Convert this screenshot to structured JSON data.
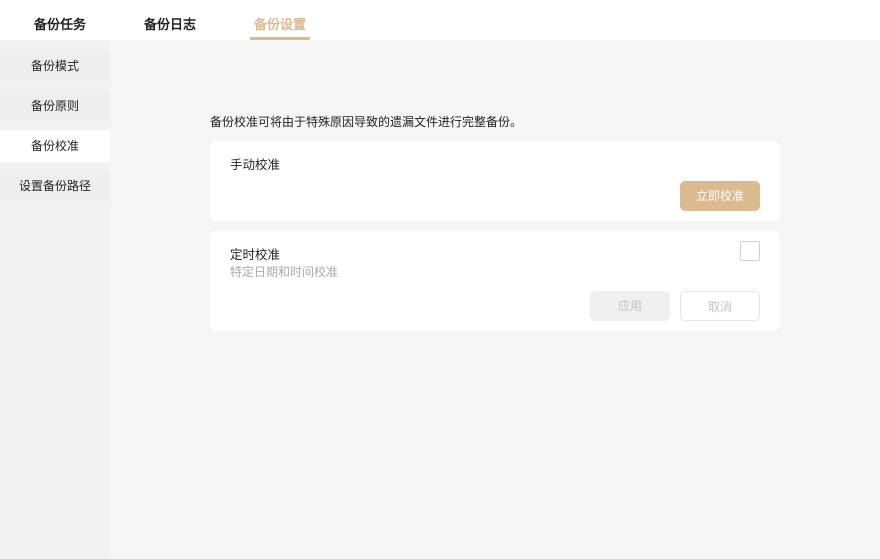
{
  "tabs": [
    {
      "label": "备份任务"
    },
    {
      "label": "备份日志"
    },
    {
      "label": "备份设置"
    }
  ],
  "sidebar": {
    "items": [
      {
        "label": "备份模式"
      },
      {
        "label": "备份原则"
      },
      {
        "label": "备份校准"
      },
      {
        "label": "设置备份路径"
      }
    ]
  },
  "main": {
    "description": "备份校准可将由于特殊原因导致的遗漏文件进行完整备份。",
    "manual": {
      "title": "手动校准",
      "button": "立即校准"
    },
    "scheduled": {
      "title": "定时校准",
      "subtitle": "特定日期和时间校准",
      "checked": false,
      "apply": "应用",
      "cancel": "取消"
    }
  },
  "colors": {
    "accent": "#dcb98e"
  }
}
